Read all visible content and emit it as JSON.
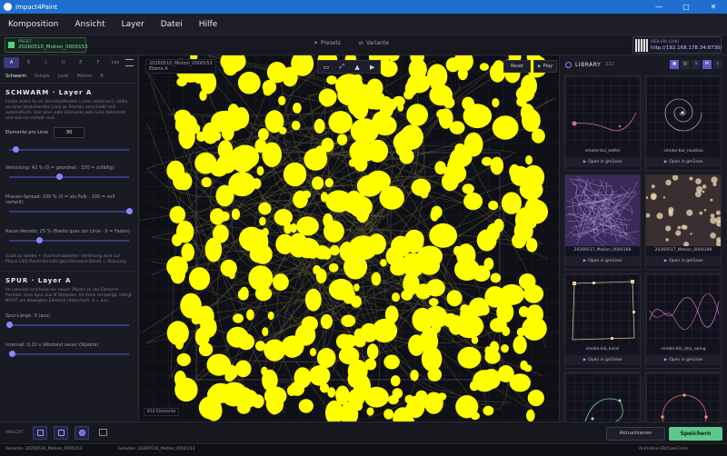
{
  "window": {
    "title": "Impact4Paint"
  },
  "menu": [
    "Komposition",
    "Ansicht",
    "Layer",
    "Datei",
    "Hilfe"
  ],
  "toolbar": {
    "preset_label": "PRESET",
    "preset_value": "20260510_Motion_0000153",
    "presets": "Presets",
    "variante": "Variante",
    "url_label": "WEB-URL (LAN)",
    "url_value": "http://192.168.178.34:8730/"
  },
  "left": {
    "layer_tabs": [
      "A",
      "B",
      "C",
      "D",
      "E",
      "F",
      "Lex"
    ],
    "sub_tabs": [
      "Schwarm",
      "Schale",
      "Look",
      "Motion",
      "B"
    ],
    "schwarm": {
      "title": "SCHWARM · Layer A",
      "desc": "Linien malst du im Vorschaufenster (‚Linie zeichnen'), ziehe an einer bestehenden Linie zu Starten verschiebt sich automatisch. Hier eine viele Elemente jede Linie bekommt und wie sie verteilt sind.",
      "elements_label": "Elemente pro Linie",
      "elements_value": "30",
      "sliders": [
        {
          "label": "",
          "value": 0.05
        },
        {
          "label": "Verteilung: 42 %  (0 = geordnet · 100 = zufällig)",
          "value": 0.42
        },
        {
          "label": "Phasen-Spread: 100 %  (0 = als Pulk · 100 = voll verteilt)",
          "value": 1.0
        },
        {
          "label": "Raum-Versatz: 25 %  (Breite quer zur Linie · 0 = Faden)",
          "value": 0.25
        }
      ],
      "note": "(Lädt zu wieder • ·Hochschubsteller: Verteilung wird auf Phase Läd) Raum-Versatz (geschlossene Band) = Streuung"
    },
    "spur": {
      "title": "SPUR · Layer A",
      "desc": "Im Intervall erscheint ein neues Objekt an der Element-Position; eine Spur aus N Objekten. Im Kreis verzweigt. Hängt NICHT am bewegten Element (detached). 0 = aus.",
      "sliders": [
        {
          "label": "Spur-Länge: 0  (aus)",
          "value": 0.0
        },
        {
          "label": "Intervall: 0.20 s  (Abstand neuer Objekte)",
          "value": 0.02
        }
      ]
    }
  },
  "canvas": {
    "tag_line1": "20260510_Motion_0000153",
    "tag_line2": "Ebene A",
    "tools": [
      "▭",
      "⤢",
      "▲",
      "▶"
    ],
    "reset": "Reset",
    "play": "Play",
    "count": "810 Elemente",
    "blob_color": "#ffff00"
  },
  "library": {
    "title": "LIBRARY",
    "count": "222",
    "view_buttons": [
      "▦",
      "▤",
      "S",
      "M",
      "L"
    ],
    "open_label": "Open in gm1exe",
    "cards": [
      {
        "name": "smoke-bio_kettel"
      },
      {
        "name": "smoke-bio_nautilus"
      },
      {
        "name": "20260517_Motion_0000168"
      },
      {
        "name": "20260517_Motion_0000189"
      },
      {
        "name": "smoke-bio_kasel"
      },
      {
        "name": "smoke-bio_dna_swing"
      },
      {
        "name": ""
      },
      {
        "name": ""
      }
    ]
  },
  "bottom": {
    "label": "ANSICHT",
    "refresh": "Aktualisieren",
    "save": "Speichern"
  },
  "status": {
    "variante": "Variante: 20260516_Motion_0000153",
    "geladen": "Geladen: 20260516_Motion_0000153",
    "path": "Animation3D/CoreCircle"
  }
}
